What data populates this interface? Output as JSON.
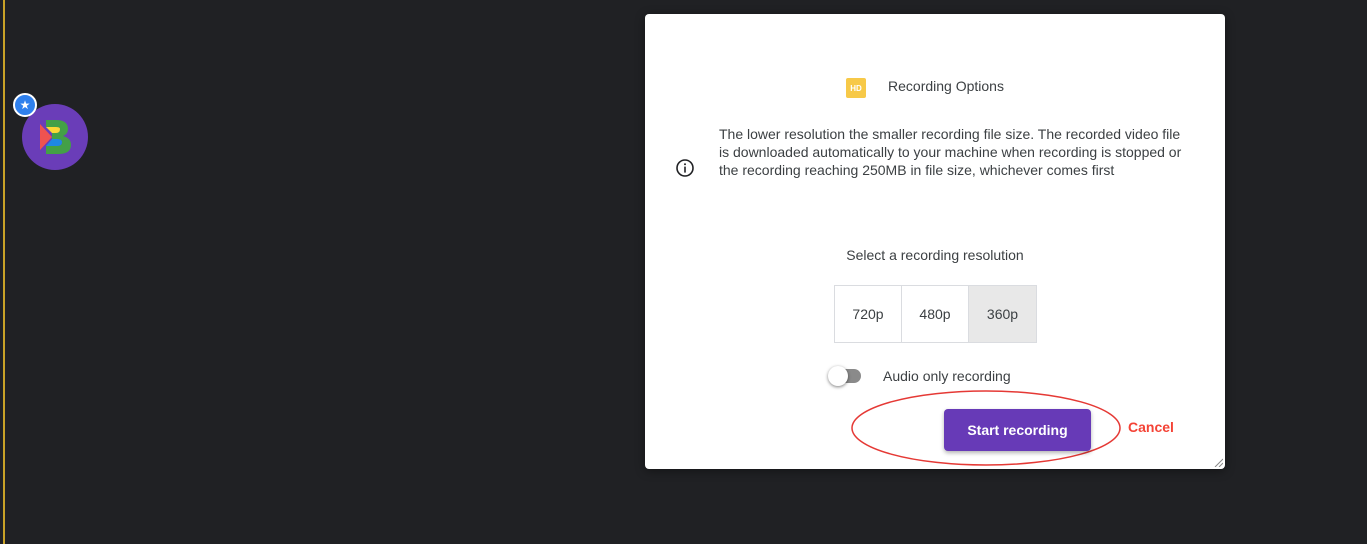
{
  "launcher": {
    "logo_icon": "app-logo-icon",
    "badge_icon": "star-icon",
    "badge_glyph": "★",
    "logo_color": "#6a3db8",
    "badge_color": "#2f80ed"
  },
  "dialog": {
    "badge_text": "HD",
    "title": "Recording Options",
    "info_icon": "info-icon",
    "info_text": "The lower resolution the smaller recording file size. The recorded video file is downloaded automatically to your machine when recording is stopped or the recording reaching 250MB in file size, whichever comes first",
    "resolution_label": "Select a recording resolution",
    "resolutions": [
      {
        "label": "720p",
        "selected": false
      },
      {
        "label": "480p",
        "selected": false
      },
      {
        "label": "360p",
        "selected": true
      }
    ],
    "audio_only": {
      "label": "Audio only recording",
      "checked": false
    },
    "start_label": "Start recording",
    "cancel_label": "Cancel",
    "colors": {
      "primary": "#673ab7",
      "cancel": "#f44336",
      "highlight": "#e53935",
      "hd_badge": "#f7c948"
    }
  }
}
